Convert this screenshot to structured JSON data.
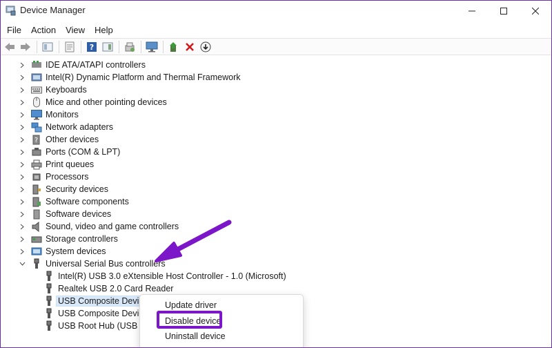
{
  "window": {
    "title": "Device Manager"
  },
  "menu": [
    "File",
    "Action",
    "View",
    "Help"
  ],
  "tree": [
    {
      "label": "IDE ATA/ATAPI controllers",
      "icon": "ide-controller-icon",
      "state": "collapsed"
    },
    {
      "label": "Intel(R) Dynamic Platform and Thermal Framework",
      "icon": "thermal-framework-icon",
      "state": "collapsed"
    },
    {
      "label": "Keyboards",
      "icon": "keyboard-icon",
      "state": "collapsed"
    },
    {
      "label": "Mice and other pointing devices",
      "icon": "mouse-icon",
      "state": "collapsed"
    },
    {
      "label": "Monitors",
      "icon": "monitor-icon",
      "state": "collapsed"
    },
    {
      "label": "Network adapters",
      "icon": "network-adapter-icon",
      "state": "collapsed"
    },
    {
      "label": "Other devices",
      "icon": "other-devices-icon",
      "state": "collapsed"
    },
    {
      "label": "Ports (COM & LPT)",
      "icon": "port-icon",
      "state": "collapsed"
    },
    {
      "label": "Print queues",
      "icon": "printer-icon",
      "state": "collapsed"
    },
    {
      "label": "Processors",
      "icon": "processor-icon",
      "state": "collapsed"
    },
    {
      "label": "Security devices",
      "icon": "security-device-icon",
      "state": "collapsed"
    },
    {
      "label": "Software components",
      "icon": "software-component-icon",
      "state": "collapsed"
    },
    {
      "label": "Software devices",
      "icon": "software-device-icon",
      "state": "collapsed"
    },
    {
      "label": "Sound, video and game controllers",
      "icon": "speaker-icon",
      "state": "collapsed"
    },
    {
      "label": "Storage controllers",
      "icon": "storage-controller-icon",
      "state": "collapsed"
    },
    {
      "label": "System devices",
      "icon": "system-device-icon",
      "state": "collapsed"
    },
    {
      "label": "Universal Serial Bus controllers",
      "icon": "usb-icon",
      "state": "expanded"
    }
  ],
  "usb_children": [
    {
      "label": "Intel(R) USB 3.0 eXtensible Host Controller - 1.0 (Microsoft)",
      "icon": "usb-icon"
    },
    {
      "label": "Realtek USB 2.0 Card Reader",
      "icon": "usb-icon"
    },
    {
      "label": "USB Composite Device",
      "icon": "usb-icon",
      "selected": true
    },
    {
      "label": "USB Composite Device",
      "icon": "usb-icon"
    },
    {
      "label": "USB Root Hub (USB 3.0)",
      "icon": "usb-icon"
    }
  ],
  "context_menu": [
    "Update driver",
    "Disable device",
    "Uninstall device"
  ],
  "colors": {
    "accent_annotation": "#7b16c9",
    "selection": "#d8e8f8"
  }
}
